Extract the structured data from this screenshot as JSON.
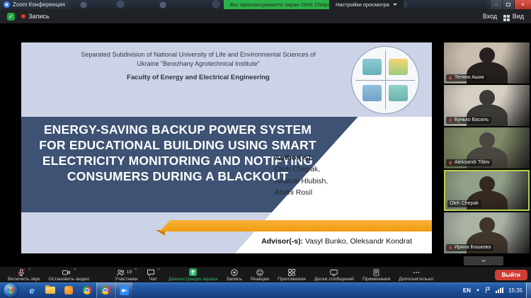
{
  "window": {
    "app_title": "Zoom Конференция",
    "share_banner": "Вы просматриваете экран Oleh Chepak",
    "view_settings_label": "Настройки просмотра",
    "recording_label": "Запись",
    "entry_label": "Вход",
    "view_label": "Вид"
  },
  "slide": {
    "institution_line1": "Separated Subdivision of National University of Life and Environmental Sciences of",
    "institution_line2": "Ukraine “Berezhany Agrotechnical Institute”",
    "faculty": "Faculty of Energy and Electrical Engineering",
    "title_lines": [
      "ENERGY-SAVING BACKUP POWER SYSTEM",
      "FOR EDUCATIONAL BUILDING USING SMART",
      "ELECTRICITY MONITORING AND NOTIFYING",
      "CONSUMERS DURING A BLACKOUT"
    ],
    "authors_label": "Author(-s):",
    "authors": [
      "Oleh Chepak,",
      "Anatolii Hlubish,",
      "Andrii Rosil"
    ],
    "advisors_label": "Advisor(-s):",
    "advisors_names": "Vasyl Bunko, Oleksandr Kondrat"
  },
  "participants": [
    {
      "name": "Тетяна Ашик",
      "muted": true,
      "active": false,
      "bg": "#c9beae",
      "fg": "#26211e"
    },
    {
      "name": "Бунько Василь",
      "muted": true,
      "active": false,
      "bg": "#d6cfc4",
      "fg": "#3c3a36"
    },
    {
      "name": "Aleksandr Titlov",
      "muted": true,
      "active": false,
      "bg": "#7f8a66",
      "fg": "#4a4640"
    },
    {
      "name": "Oleh Chepak",
      "muted": false,
      "active": true,
      "bg": "#93a089",
      "fg": "#33291f"
    },
    {
      "name": "Ирина Бошкова",
      "muted": true,
      "active": false,
      "bg": "#aab3a4",
      "fg": "#3f352a"
    }
  ],
  "toolbar": {
    "items": [
      {
        "label": "Включить звук",
        "icon": "mic-muted",
        "chevron": true
      },
      {
        "label": "Остановить видео",
        "icon": "camera",
        "chevron": true
      },
      {
        "label": "Участники",
        "icon": "participants",
        "chevron": true,
        "badge": "19"
      },
      {
        "label": "Чат",
        "icon": "chat",
        "chevron": true
      },
      {
        "label": "Демонстрация экрана",
        "icon": "share-screen",
        "green": true
      },
      {
        "label": "Запись",
        "icon": "record"
      },
      {
        "label": "Реакции",
        "icon": "reactions"
      },
      {
        "label": "Приложения",
        "icon": "apps"
      },
      {
        "label": "Доски сообщений",
        "icon": "whiteboard"
      },
      {
        "label": "Примечания",
        "icon": "notes"
      },
      {
        "label": "Дополнительно",
        "icon": "more"
      }
    ],
    "leave_label": "Выйти"
  },
  "taskbar": {
    "language": "EN",
    "time": "15:35"
  },
  "colors": {
    "banner_green": "#29b34b",
    "share_green": "#2eb563",
    "leave_red": "#cf3e36",
    "active_speaker_border": "#b5d247",
    "slide_title_band": "#3e5273",
    "slide_header_bg": "#ccd3e6",
    "slide_accent_orange": "#f6a21d"
  }
}
